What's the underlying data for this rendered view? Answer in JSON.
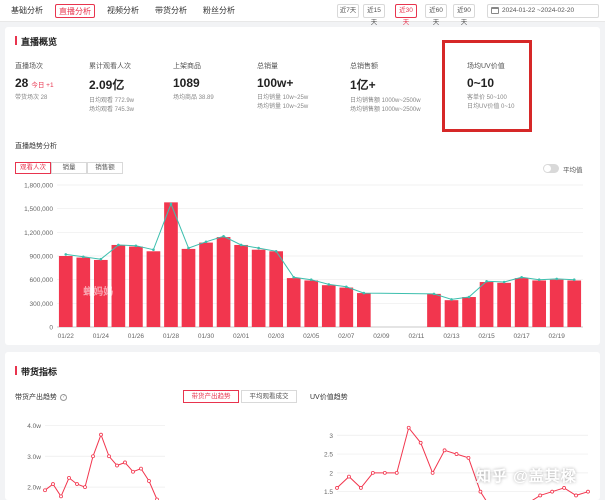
{
  "tabs": [
    "基础分析",
    "直播分析",
    "视频分析",
    "带货分析",
    "粉丝分析"
  ],
  "active_tab": 1,
  "date_ranges": [
    "近7天",
    "近15天",
    "近30天",
    "近60天",
    "近90天"
  ],
  "active_range": 2,
  "date_range_value": "2024-01-22  ~2024-02-20",
  "live_overview": {
    "title": "直播概览",
    "metrics": [
      {
        "label": "直播场次",
        "value": "28",
        "today_label": "今日",
        "today_value": "+1",
        "sub": [
          "带货场次  28"
        ]
      },
      {
        "label": "累计观看人次",
        "value": "2.09亿",
        "sub": [
          "日均观看  772.9w",
          "场均观看  745.3w"
        ]
      },
      {
        "label": "上架商品",
        "value": "1089",
        "sub": [
          "场均商品  38.89"
        ]
      },
      {
        "label": "总销量",
        "value": "100w+",
        "sub": [
          "日均销量  10w~25w",
          "场均销量  10w~25w"
        ]
      },
      {
        "label": "总销售额",
        "value": "1亿+",
        "sub": [
          "日均销售额  1000w~2500w",
          "场均销售额  1000w~2500w"
        ]
      },
      {
        "label": "场均UV价值",
        "value": "0~10",
        "sub": [
          "客单价  50~100",
          "日均UV价值  0~10"
        ]
      }
    ]
  },
  "trend": {
    "title": "直播趋势分析",
    "tabs": [
      "观看人次",
      "销量",
      "销售额"
    ],
    "active_tab": 0,
    "avg_toggle_label": "平均值",
    "watermark": "蝉妈妈"
  },
  "chart_data": [
    {
      "type": "bar",
      "title": "",
      "y_tick_labels": [
        "0",
        "300,000",
        "600,000",
        "900,000",
        "1,200,000",
        "1,500,000",
        "1,800,000"
      ],
      "ylim": [
        0,
        1800000
      ],
      "x": [
        "01/22",
        "01/23",
        "01/24",
        "01/25",
        "01/26",
        "01/27",
        "01/28",
        "01/29",
        "01/30",
        "01/31",
        "02/01",
        "02/02",
        "02/03",
        "02/04",
        "02/05",
        "02/06",
        "02/07",
        "02/08",
        "02/09",
        "02/10",
        "02/11",
        "02/12",
        "02/13",
        "02/14",
        "02/15",
        "02/16",
        "02/17",
        "02/18",
        "02/19",
        "02/20"
      ],
      "x_tick_labels": [
        "01/22",
        "01/24",
        "01/26",
        "01/28",
        "01/30",
        "02/01",
        "02/03",
        "02/05",
        "02/07",
        "02/09",
        "02/11",
        "02/13",
        "02/15",
        "02/17",
        "02/19"
      ],
      "values": [
        900000,
        880000,
        850000,
        1040000,
        1020000,
        960000,
        1580000,
        990000,
        1070000,
        1140000,
        1040000,
        980000,
        960000,
        620000,
        590000,
        530000,
        500000,
        430000,
        null,
        null,
        null,
        420000,
        340000,
        380000,
        570000,
        560000,
        620000,
        590000,
        600000,
        590000
      ],
      "line_values": [
        920000,
        890000,
        860000,
        1040000,
        1030000,
        980000,
        1560000,
        1000000,
        1080000,
        1150000,
        1040000,
        1000000,
        960000,
        630000,
        600000,
        540000,
        510000,
        430000,
        null,
        null,
        null,
        420000,
        350000,
        380000,
        580000,
        570000,
        630000,
        600000,
        610000,
        600000
      ],
      "bar_color": "#f2364e",
      "line_color": "#3dbfae",
      "grid": true
    },
    {
      "type": "line",
      "title": "",
      "y_tick_labels": [
        "2.0w",
        "3.0w",
        "4.0w"
      ],
      "ylim": [
        1.0,
        4.5
      ],
      "values": [
        1.9,
        2.1,
        1.7,
        2.3,
        2.1,
        2.0,
        3.0,
        3.7,
        3.0,
        2.7,
        2.8,
        2.5,
        2.6,
        2.2,
        1.6,
        1.2
      ],
      "line_color": "#f2364e",
      "grid": true
    },
    {
      "type": "line",
      "title": "",
      "y_tick_labels": [
        "1",
        "1.5",
        "2",
        "2.5",
        "3"
      ],
      "ylim": [
        0.8,
        3.3
      ],
      "values": [
        1.6,
        1.9,
        1.6,
        2.0,
        2.0,
        2.0,
        3.2,
        2.8,
        2.0,
        2.6,
        2.5,
        2.4,
        1.5,
        1.0,
        0.9,
        1.0,
        1.2,
        1.4,
        1.5,
        1.6,
        1.4,
        1.5
      ],
      "line_color": "#f2364e",
      "grid": true
    }
  ],
  "goods": {
    "title": "带货指标",
    "left_title": "带货产出趋势",
    "tabs": [
      "带货产出趋势",
      "平均观看成交"
    ],
    "active_tab": 0,
    "right_title": "UV价值趋势"
  },
  "footer_watermark": "知乎 @盖其樑"
}
